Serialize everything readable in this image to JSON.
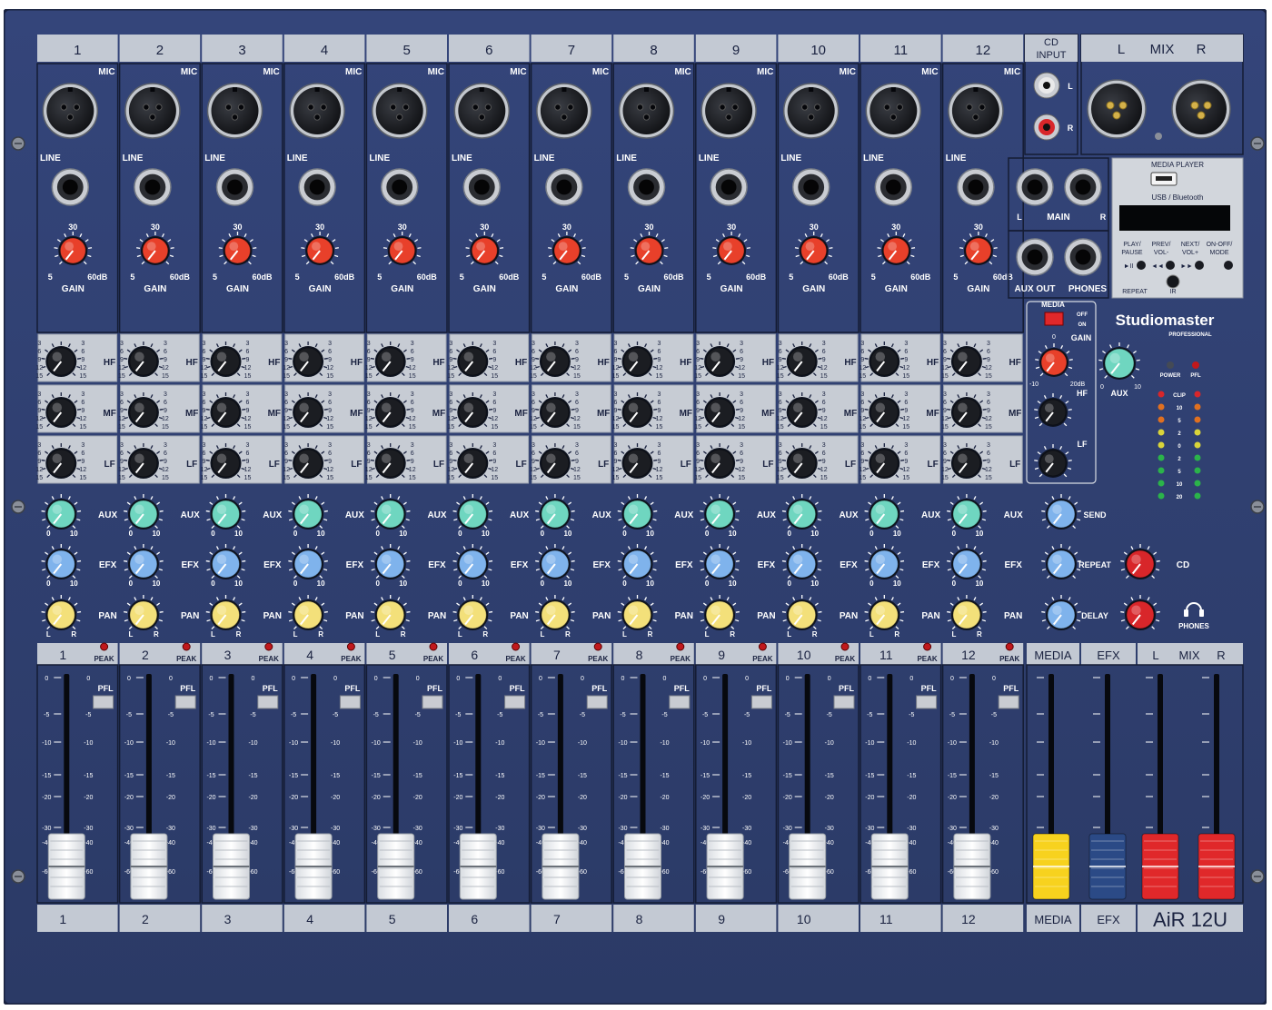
{
  "colors": {
    "panel": "#2b3a66",
    "panel_dark": "#1d2a4f",
    "strip_label": "#c3c9d3",
    "gain_knob": "#e8402a",
    "aux_knob": "#6fd6c0",
    "efx_knob": "#7fb3ec",
    "pan_knob": "#f3e07a",
    "eq_knob": "#1b1d22",
    "cd_knob": "#d8262a",
    "fader_white": "#f3f4f6",
    "fader_yellow": "#f7d21e",
    "fader_blue": "#2b4a86",
    "fader_red": "#e0282a",
    "peak_led": "#c0181c"
  },
  "channels": [
    "1",
    "2",
    "3",
    "4",
    "5",
    "6",
    "7",
    "8",
    "9",
    "10",
    "11",
    "12"
  ],
  "labels": {
    "mic": "MIC",
    "line": "LINE",
    "gain": "GAIN",
    "gain_min": "5",
    "gain_mid": "30",
    "gain_max": "60dB",
    "hf": "HF",
    "mf": "MF",
    "lf": "LF",
    "aux": "AUX",
    "efx": "EFX",
    "pan": "PAN",
    "peak": "PEAK",
    "pfl": "PFL",
    "knob_min": "0",
    "knob_max": "10",
    "pan_l": "L",
    "pan_r": "R"
  },
  "eq_scale": [
    "3",
    "6",
    "9",
    "12",
    "15"
  ],
  "fader_scale": [
    "0",
    "-5",
    "-10",
    "-15",
    "-20",
    "-30",
    "-40",
    "-60"
  ],
  "cd_input": {
    "title_1": "CD",
    "title_2": "INPUT",
    "l": "L",
    "r": "R"
  },
  "mix_out": {
    "l": "L",
    "title": "MIX",
    "r": "R"
  },
  "main_out": {
    "label": "MAIN",
    "l": "L",
    "r": "R"
  },
  "aux_out": "AUX OUT",
  "phones_out": "PHONES",
  "media_player": {
    "title": "MEDIA PLAYER",
    "sub": "USB / Bluetooth",
    "buttons": [
      "PLAY/ PAUSE",
      "PREV/ VOL-",
      "NEXT/ VOL+",
      "ON-OFF/ MODE"
    ],
    "icons": [
      "►II",
      "◄◄",
      "►►",
      ""
    ],
    "repeat": "REPEAT",
    "ir": "IR"
  },
  "media_section": {
    "title": "MEDIA",
    "off": "OFF",
    "on": "ON",
    "gain": "GAIN",
    "gain_min": "-10",
    "gain_max": "20dB",
    "hf": "HF",
    "lf": "LF"
  },
  "brand": {
    "name": "Studiomaster",
    "sub": "PROFESSIONAL"
  },
  "master": {
    "aux": "AUX",
    "power": "POWER",
    "pfl": "PFL",
    "meter": [
      "CLIP",
      "10",
      "5",
      "2",
      "0",
      "2",
      "5",
      "10",
      "20"
    ],
    "send": "SEND",
    "repeat": "REPEAT",
    "delay": "DELAY",
    "cd": "CD",
    "phones": "PHONES"
  },
  "bottom_labels": {
    "media": "MEDIA",
    "efx": "EFX",
    "mix_l": "L",
    "mix": "MIX",
    "mix_r": "R"
  },
  "model": "AiR 12U"
}
